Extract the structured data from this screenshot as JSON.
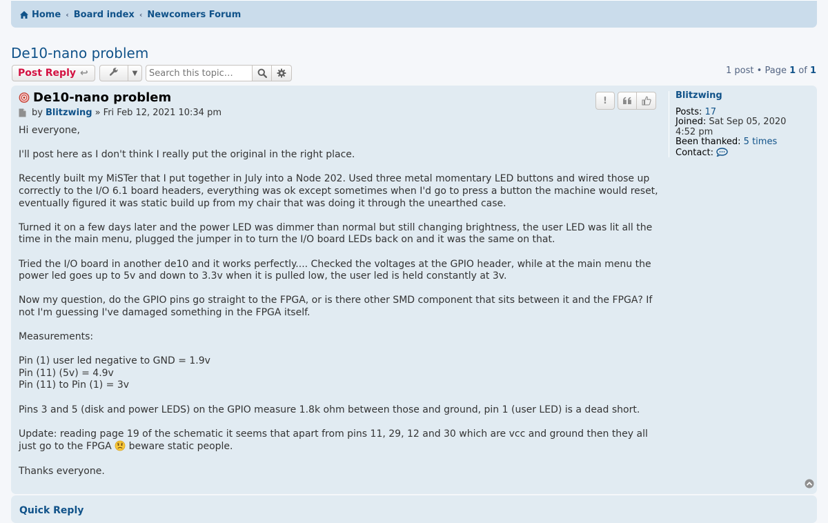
{
  "breadcrumbs": {
    "home": "Home",
    "board_index": "Board index",
    "forum": "Newcomers Forum"
  },
  "topic": {
    "title": "De10-nano problem"
  },
  "action_bar": {
    "post_reply_label": "Post Reply",
    "search_placeholder": "Search this topic…",
    "search_value": ""
  },
  "pagination": {
    "post_count": "1 post",
    "page_label": "Page",
    "current_page": "1",
    "of_label": "of",
    "total_pages": "1"
  },
  "post": {
    "title": "De10-nano problem",
    "by_label": "by",
    "author": "Blitzwing",
    "date": "» Fri Feb 12, 2021 10:34 pm",
    "paragraphs": [
      "Hi everyone,",
      "I'll post here as I don't think I really put the original in the right place.",
      "Recently built my MiSTer that I put together in July into a Node 202. Used three metal momentary LED buttons and wired those up correctly to the I/O 6.1 board headers, everything was ok except sometimes when I'd go to press a button the machine would reset, eventually figured it was static build up from my chair that was doing it through the unearthed case.",
      "Turned it on a few days later and the power LED was dimmer than normal but still changing brightness, the user LED was lit all the time in the main menu, plugged the jumper in to turn the I/O board LEDs back on and it was the same on that.",
      "Tried the I/O board in another de10 and it works perfectly.... Checked the voltages at the GPIO header, while at the main menu the power led goes up to 5v and down to 3.3v when it is pulled low, the user led is held constantly at 3v.",
      "Now my question, do the GPIO pins go straight to the FPGA, or is there other SMD component that sits between it and the FPGA? If not I'm guessing I've damaged something in the FPGA itself.",
      "Measurements:"
    ],
    "measurements": [
      "Pin (1) user led negative to GND = 1.9v",
      "Pin (11) (5v) = 4.9v",
      "Pin (11) to Pin (1) = 3v"
    ],
    "pins_paragraph": "Pins 3 and 5 (disk and power LEDS) on the GPIO measure 1.8k ohm between those and ground, pin 1 (user LED) is a dead short.",
    "update_before": "Update: reading page 19 of the schematic it seems that apart from pins 11, 29, 12 and 30 which are vcc and ground then they all just go to the FPGA",
    "update_after": "beware static people.",
    "thanks": "Thanks everyone."
  },
  "post_buttons": {
    "report": "!",
    "quote": "❝",
    "thanks": "👍"
  },
  "profile": {
    "username": "Blitzwing",
    "posts_label": "Posts:",
    "posts_value": "17",
    "joined_label": "Joined:",
    "joined_value": "Sat Sep 05, 2020 4:52 pm",
    "thanked_label": "Been thanked:",
    "thanked_value": "5 times",
    "contact_label": "Contact:"
  },
  "quick_reply": {
    "label": "Quick Reply"
  },
  "colors": {
    "link": "#105289",
    "reply_red": "#d31141",
    "post_bg": "#e1ebf2",
    "nav_bg": "#cadceb"
  }
}
